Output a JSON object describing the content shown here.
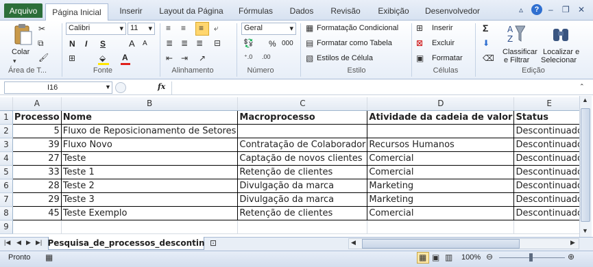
{
  "ribbon_tabs": {
    "file": "Arquivo",
    "home": "Página Inicial",
    "insert": "Inserir",
    "layout": "Layout da Página",
    "formulas": "Fórmulas",
    "data": "Dados",
    "review": "Revisão",
    "view": "Exibição",
    "developer": "Desenvolvedor"
  },
  "clipboard": {
    "paste": "Colar",
    "group": "Área de T..."
  },
  "font": {
    "name": "Calibri",
    "size": "11",
    "bold": "N",
    "italic": "I",
    "underline": "S",
    "grow": "A",
    "shrink": "A",
    "color_letter": "A",
    "group": "Fonte"
  },
  "alignment": {
    "group": "Alinhamento"
  },
  "number": {
    "format": "Geral",
    "percent": "%",
    "thousands": "000",
    "group": "Número"
  },
  "styles": {
    "conditional": "Formatação Condicional",
    "as_table": "Formatar como Tabela",
    "cell_styles": "Estilos de Célula",
    "group": "Estilo"
  },
  "cells": {
    "insert": "Inserir",
    "delete": "Excluir",
    "format": "Formatar",
    "group": "Células"
  },
  "editing": {
    "sigma": "Σ",
    "sort1": "Classificar",
    "sort2": "e Filtrar",
    "find1": "Localizar e",
    "find2": "Selecionar",
    "group": "Edição"
  },
  "formula_bar": {
    "cell": "I16",
    "fx": "fx",
    "value": ""
  },
  "columns": [
    "",
    "A",
    "B",
    "C",
    "D",
    "E"
  ],
  "rows": [
    {
      "n": "1",
      "a": "Processo",
      "b": "Nome",
      "c": "Macroprocesso",
      "d": "Atividade da cadeia de valor",
      "e": "Status"
    },
    {
      "n": "2",
      "a": "5",
      "b": "Fluxo de Reposicionamento de Setores",
      "c": "",
      "d": "",
      "e": "Descontinuado"
    },
    {
      "n": "3",
      "a": "39",
      "b": "Fluxo Novo",
      "c": "Contratação de Colaborador",
      "d": "Recursos Humanos",
      "e": "Descontinuado"
    },
    {
      "n": "4",
      "a": "27",
      "b": "Teste",
      "c": "Captação de novos clientes",
      "d": "Comercial",
      "e": "Descontinuado"
    },
    {
      "n": "5",
      "a": "33",
      "b": "Teste 1",
      "c": "Retenção de clientes",
      "d": "Comercial",
      "e": "Descontinuado"
    },
    {
      "n": "6",
      "a": "28",
      "b": "Teste 2",
      "c": "Divulgação da marca",
      "d": "Marketing",
      "e": "Descontinuado"
    },
    {
      "n": "7",
      "a": "29",
      "b": "Teste 3",
      "c": "Divulgação da marca",
      "d": "Marketing",
      "e": "Descontinuado"
    },
    {
      "n": "8",
      "a": "45",
      "b": "Teste Exemplo",
      "c": "Retenção de clientes",
      "d": "Comercial",
      "e": "Descontinuado"
    },
    {
      "n": "9",
      "a": "",
      "b": "",
      "c": "",
      "d": "",
      "e": ""
    }
  ],
  "sheet_tab": "Pesquisa_de_processos_descontin",
  "status": {
    "ready": "Pronto",
    "zoom": "100%"
  }
}
